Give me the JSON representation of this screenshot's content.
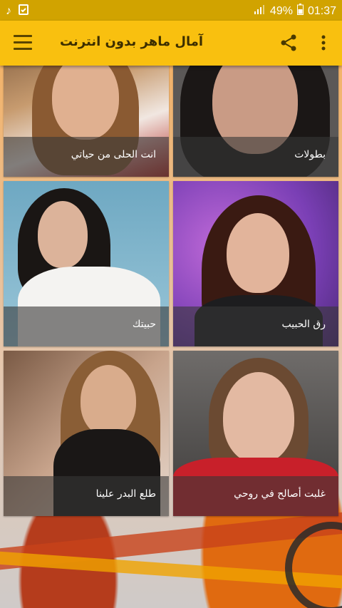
{
  "status_bar": {
    "signal": "49%",
    "time": "01:37",
    "colors": {
      "background": "#d1a300"
    }
  },
  "app_bar": {
    "title": "آمال ماهر بدون انترنت",
    "icons": {
      "menu": "hamburger-menu-icon",
      "share": "share-icon",
      "more": "more-vertical-icon"
    },
    "colors": {
      "background": "#f9c00f"
    }
  },
  "songs": [
    {
      "title": "انت الحلى من حياتي"
    },
    {
      "title": "بطولات"
    },
    {
      "title": "حبيتك"
    },
    {
      "title": "رق الحبيب"
    },
    {
      "title": "طلع البدر علينا"
    },
    {
      "title": "غلبت أصالح في روحي"
    }
  ]
}
